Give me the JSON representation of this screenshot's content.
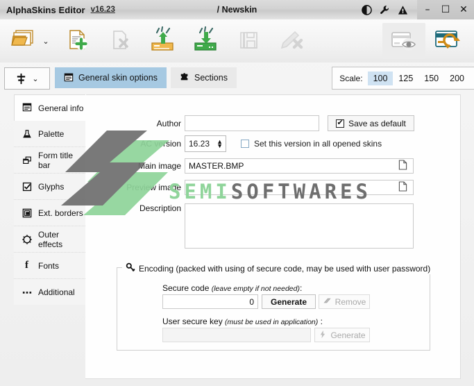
{
  "titlebar": {
    "app_title": "AlphaSkins Editor",
    "version": "v16.23",
    "document": "/ Newskin",
    "icons": [
      {
        "name": "contrast-icon",
        "glyph": "◐"
      },
      {
        "name": "wrench-icon",
        "glyph": "🔧"
      },
      {
        "name": "warning-icon",
        "glyph": "⚠"
      }
    ],
    "window_buttons": [
      {
        "name": "minimize-button",
        "glyph": "–"
      },
      {
        "name": "maximize-button",
        "glyph": "☐"
      },
      {
        "name": "close-button",
        "glyph": "✕"
      }
    ]
  },
  "toolbar": {
    "buttons": [
      {
        "name": "open-skin-button",
        "icon": "open-folder-icon",
        "enabled": true
      },
      {
        "name": "open-dropdown-button",
        "icon": "chevron-down-icon",
        "enabled": true
      },
      {
        "name": "new-skin-button",
        "icon": "new-document-plus-icon",
        "enabled": true
      },
      {
        "name": "close-skin-button",
        "icon": "document-delete-icon",
        "enabled": false
      },
      {
        "name": "export-skin-button",
        "icon": "upload-arrow-icon",
        "enabled": true
      },
      {
        "name": "import-skin-button",
        "icon": "download-arrow-icon",
        "enabled": true
      },
      {
        "name": "save-skin-button",
        "icon": "floppy-save-icon",
        "enabled": false
      },
      {
        "name": "edit-delete-button",
        "icon": "pencil-delete-icon",
        "enabled": false
      },
      {
        "name": "preview-skin-button",
        "icon": "preview-eye-icon",
        "enabled": true
      },
      {
        "name": "refresh-skin-button",
        "icon": "refresh-card-icon",
        "enabled": true
      }
    ]
  },
  "tabstrip": {
    "dropdown": {
      "name": "layout-dropdown",
      "icon": "signpost-icon",
      "chevron": "⌄"
    },
    "tabs": [
      {
        "label": "General  skin options",
        "icon": "notepad-icon",
        "selected": true
      },
      {
        "label": "Sections",
        "icon": "puzzle-piece-icon",
        "selected": false
      }
    ],
    "scale": {
      "label": "Scale:",
      "options": [
        "100",
        "125",
        "150",
        "200"
      ],
      "selected": "100"
    }
  },
  "sidebar": {
    "header": {
      "label": "General info",
      "icon": "notepad-icon"
    },
    "items": [
      {
        "label": "Palette",
        "icon": "flask-icon"
      },
      {
        "label": "Form title bar",
        "icon": "windows-stack-icon"
      },
      {
        "label": "Glyphs",
        "icon": "checkbox-icon"
      },
      {
        "label": "Ext. borders",
        "icon": "frame-borders-icon"
      },
      {
        "label": "Outer effects",
        "icon": "gear-outline-icon"
      },
      {
        "label": "Fonts",
        "icon": "font-f-icon"
      },
      {
        "label": "Additional",
        "icon": "ellipsis-icon"
      }
    ]
  },
  "form": {
    "author": {
      "label": "Author",
      "value": "",
      "placeholder": ""
    },
    "save_as_default": {
      "label": "Save as default",
      "checked": true,
      "icon": "check-icon"
    },
    "ac_version": {
      "label": "AC version",
      "value": "16.23"
    },
    "set_version_all": {
      "label": "Set this version in all opened skins",
      "checked": false
    },
    "main_image": {
      "label": "Main image",
      "value": "MASTER.BMP",
      "browse_icon": "document-browse-icon"
    },
    "preview_image": {
      "label": "Preview image",
      "value": "",
      "browse_icon": "document-browse-icon"
    },
    "description": {
      "label": "Description",
      "value": ""
    }
  },
  "encoding": {
    "title": "Encoding (packed with using of secure code, may be used with user password)",
    "title_icon": "key-icon",
    "secure_code": {
      "label_main": "Secure code ",
      "label_hint": "(leave empty if not needed)",
      "label_tail": ":",
      "value": "0",
      "generate_label": "Generate",
      "remove_label": "Remove",
      "remove_icon": "eraser-icon",
      "remove_enabled": false
    },
    "user_secure_key": {
      "label_main": "User secure key ",
      "label_hint": "(must be used in application)",
      "label_tail": " :",
      "value": "",
      "generate_label": "Generate",
      "generate_icon": "lightning-icon",
      "generate_enabled": false
    }
  },
  "watermark": {
    "text_left": "SEMI",
    "text_right": "SOFTWARES",
    "color_green": "#8fd49a",
    "color_gray": "#6e6e6e"
  },
  "colors": {
    "tab_selected": "#a6c9e2",
    "scale_selected": "#cfe2f2",
    "accent_orange": "#cf8b16",
    "accent_green": "#3faa4a",
    "panel_bg": "#fefefe"
  }
}
